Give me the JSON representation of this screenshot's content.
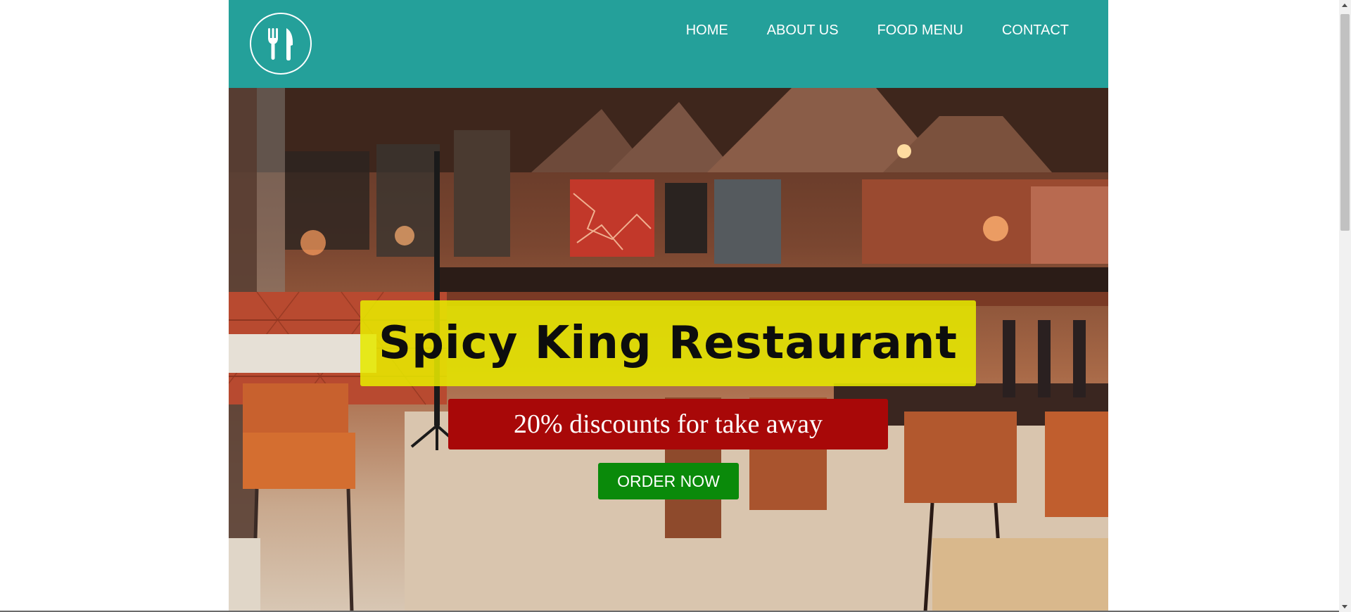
{
  "nav": {
    "items": [
      "HOME",
      "ABOUT US",
      "FOOD MENU",
      "CONTACT"
    ]
  },
  "logo": {
    "icon": "fork-knife-icon"
  },
  "hero": {
    "title": "Spicy King Restaurant",
    "subtitle": "20% discounts for take away",
    "cta_label": "ORDER NOW"
  },
  "colors": {
    "header": "#24a09a",
    "title_bg": "#e6e800",
    "subtitle_bg": "#a80808",
    "cta_bg": "#0a8a0a"
  }
}
